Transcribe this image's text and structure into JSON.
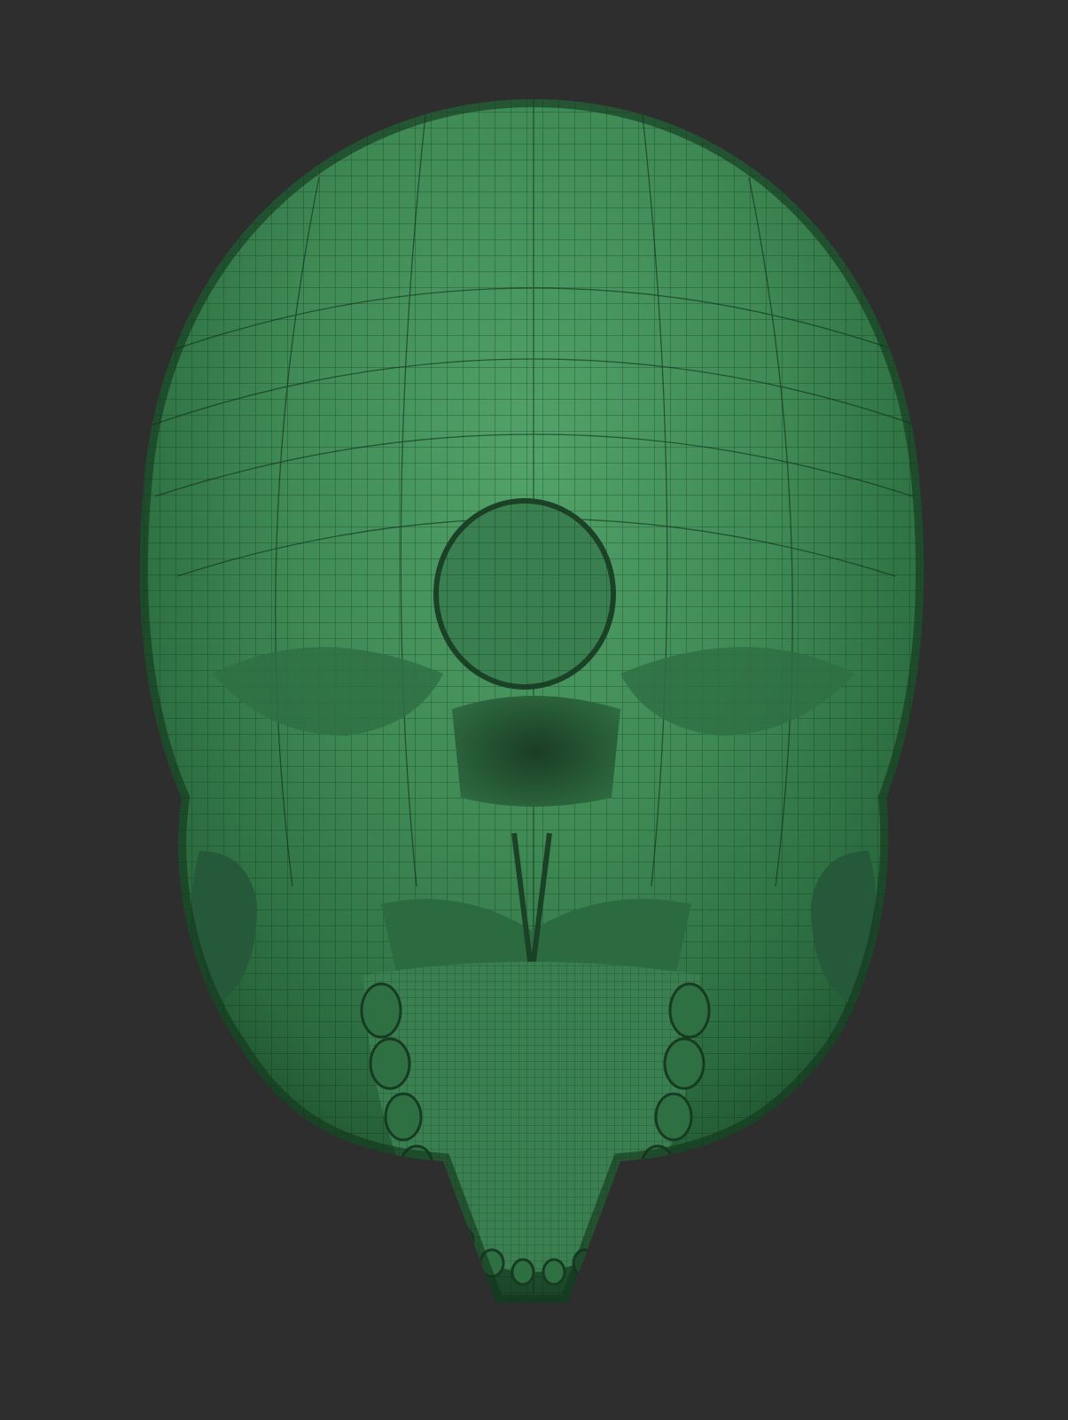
{
  "viewport": {
    "background_color": "#2e2e2e",
    "subject": "skull-inferior-view-wireframe",
    "material_color": "#3f8a55",
    "wire_color": "#0f2a17"
  }
}
